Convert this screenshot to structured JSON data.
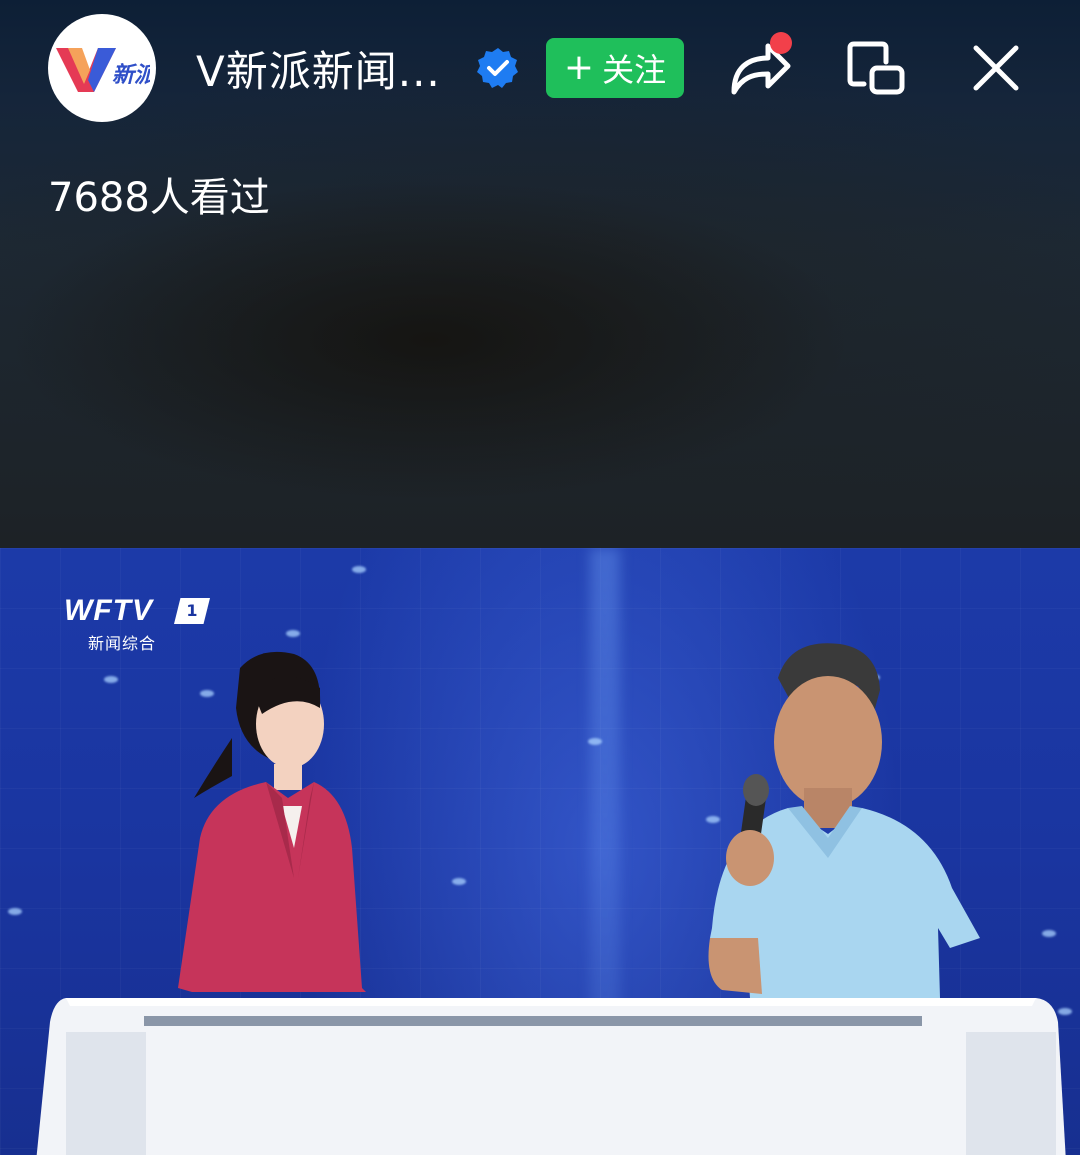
{
  "header": {
    "avatar_logo_text": "新派",
    "channel_name": "V新派新闻...",
    "follow_label": "关注",
    "follow_plus": "+",
    "views_text": "7688人看过"
  },
  "icons": {
    "avatar": "v-xinpai-logo",
    "verified": "verified-badge-icon",
    "share": "share-arrow-icon",
    "pip": "picture-in-picture-icon",
    "close": "close-icon"
  },
  "colors": {
    "follow_green": "#1fbf5b",
    "verified_blue": "#1e7cf2",
    "notification_red": "#f2404a",
    "studio_blue": "#1a35a0"
  },
  "video": {
    "station_logo": "WFTV",
    "channel_number": "1",
    "station_subtitle": "新闻综合"
  }
}
